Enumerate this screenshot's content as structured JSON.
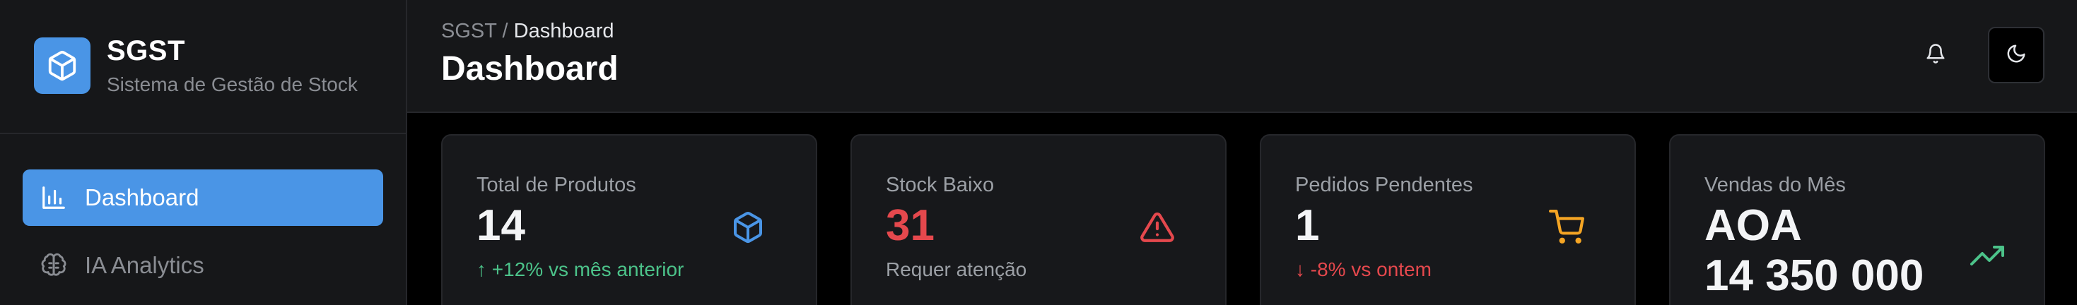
{
  "brand": {
    "title": "SGST",
    "subtitle": "Sistema de Gestão de Stock",
    "logo_icon": "package-cube-icon",
    "accent": "#4a95e6"
  },
  "sidebar": {
    "items": [
      {
        "label": "Dashboard",
        "icon": "bar-chart-icon",
        "active": true
      },
      {
        "label": "IA Analytics",
        "icon": "brain-icon",
        "active": false
      }
    ]
  },
  "header": {
    "breadcrumb": {
      "root": "SGST",
      "separator": "/",
      "current": "Dashboard"
    },
    "title": "Dashboard",
    "actions": [
      {
        "icon": "bell-icon"
      },
      {
        "icon": "moon-icon"
      }
    ]
  },
  "stats": [
    {
      "label": "Total de Produtos",
      "value": "14",
      "sub_arrow": "↑",
      "sub_text": "+12% vs mês anterior",
      "sub_tone": "up",
      "icon": "package-cube-icon",
      "icon_color": "#4a95e6"
    },
    {
      "label": "Stock Baixo",
      "value": "31",
      "sub_arrow": "",
      "sub_text": "Requer atenção",
      "sub_tone": "muted",
      "icon": "warning-triangle-icon",
      "icon_color": "#e5484d"
    },
    {
      "label": "Pedidos Pendentes",
      "value": "1",
      "sub_arrow": "↓",
      "sub_text": "-8% vs ontem",
      "sub_tone": "down",
      "icon": "shopping-cart-icon",
      "icon_color": "#f5a524"
    },
    {
      "label": "Vendas do Mês",
      "value_line1": "AOA",
      "value_line2": "14 350 000",
      "icon": "trending-up-icon",
      "icon_color": "#4cc38a"
    }
  ]
}
